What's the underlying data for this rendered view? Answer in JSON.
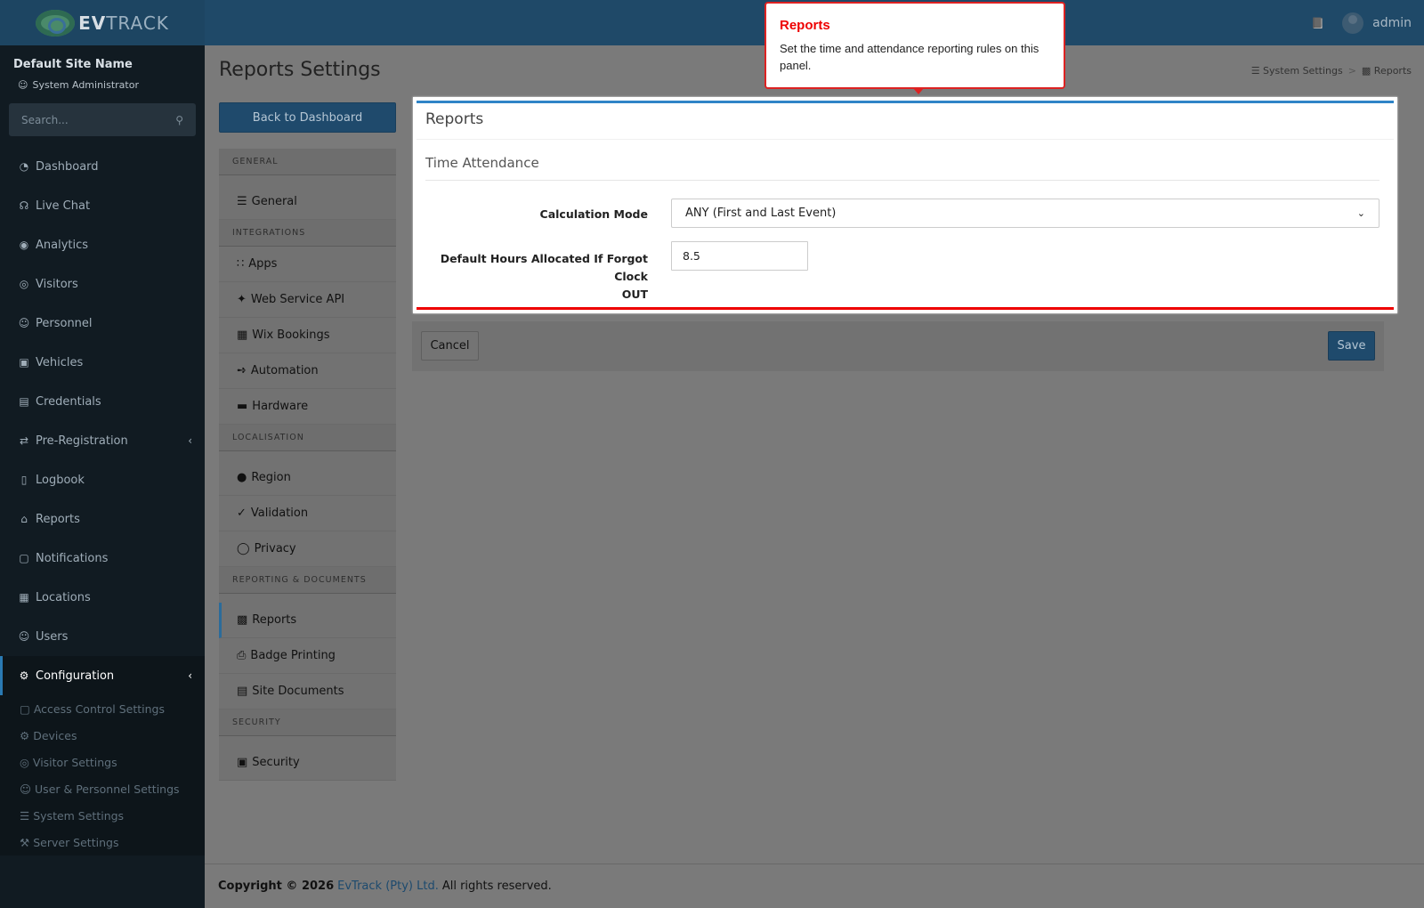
{
  "header": {
    "brand_bold": "EV",
    "brand_rest": "TRACK",
    "user": "admin",
    "doc_icon": "📕"
  },
  "sidebar": {
    "site_name": "Default Site Name",
    "role": "System Administrator",
    "search_placeholder": "Search...",
    "items": [
      {
        "label": "Dashboard",
        "icon": "◔"
      },
      {
        "label": "Live Chat",
        "icon": "☊"
      },
      {
        "label": "Analytics",
        "icon": "◉"
      },
      {
        "label": "Visitors",
        "icon": "◎"
      },
      {
        "label": "Personnel",
        "icon": "☺"
      },
      {
        "label": "Vehicles",
        "icon": "▣"
      },
      {
        "label": "Credentials",
        "icon": "▤"
      },
      {
        "label": "Pre-Registration",
        "icon": "⇄"
      },
      {
        "label": "Logbook",
        "icon": "▯"
      },
      {
        "label": "Reports",
        "icon": "⌂"
      },
      {
        "label": "Notifications",
        "icon": "▢"
      },
      {
        "label": "Locations",
        "icon": "▦"
      },
      {
        "label": "Users",
        "icon": "☺"
      },
      {
        "label": "Configuration",
        "icon": "⚙"
      }
    ],
    "config_sub": [
      {
        "label": "Access Control Settings",
        "icon": "▢"
      },
      {
        "label": "Devices",
        "icon": "⚙"
      },
      {
        "label": "Visitor Settings",
        "icon": "◎"
      },
      {
        "label": "User & Personnel Settings",
        "icon": "☺"
      },
      {
        "label": "System Settings",
        "icon": "☰"
      },
      {
        "label": "Server Settings",
        "icon": "⚒"
      }
    ]
  },
  "page": {
    "title": "Reports Settings",
    "crumb1": "System Settings",
    "crumb2": "Reports",
    "back_label": "Back to Dashboard"
  },
  "settings_nav": {
    "general_h": "GENERAL",
    "general": "General",
    "integrations_h": "INTEGRATIONS",
    "apps": "Apps",
    "webapi": "Web Service API",
    "wix": "Wix Bookings",
    "automation": "Automation",
    "hardware": "Hardware",
    "localisation_h": "LOCALISATION",
    "region": "Region",
    "validation": "Validation",
    "privacy": "Privacy",
    "reporting_h": "REPORTING & DOCUMENTS",
    "reports": "Reports",
    "badge": "Badge Printing",
    "sitedocs": "Site Documents",
    "security_h": "SECURITY",
    "security": "Security"
  },
  "panel": {
    "title": "Reports",
    "section": "Time Attendance",
    "calc_label": "Calculation Mode",
    "calc_value": "ANY (First and Last Event)",
    "hours_label_1": "Default Hours Allocated If Forgot Clock",
    "hours_label_2": "OUT",
    "hours_value": "8.5"
  },
  "actions": {
    "cancel": "Cancel",
    "save": "Save"
  },
  "tooltip": {
    "title": "Reports",
    "body": "Set the time and attendance reporting rules on this panel."
  },
  "footer": {
    "copyright": "Copyright © 2026",
    "company": "EvTrack (Pty) Ltd.",
    "rights": "All rights reserved."
  }
}
